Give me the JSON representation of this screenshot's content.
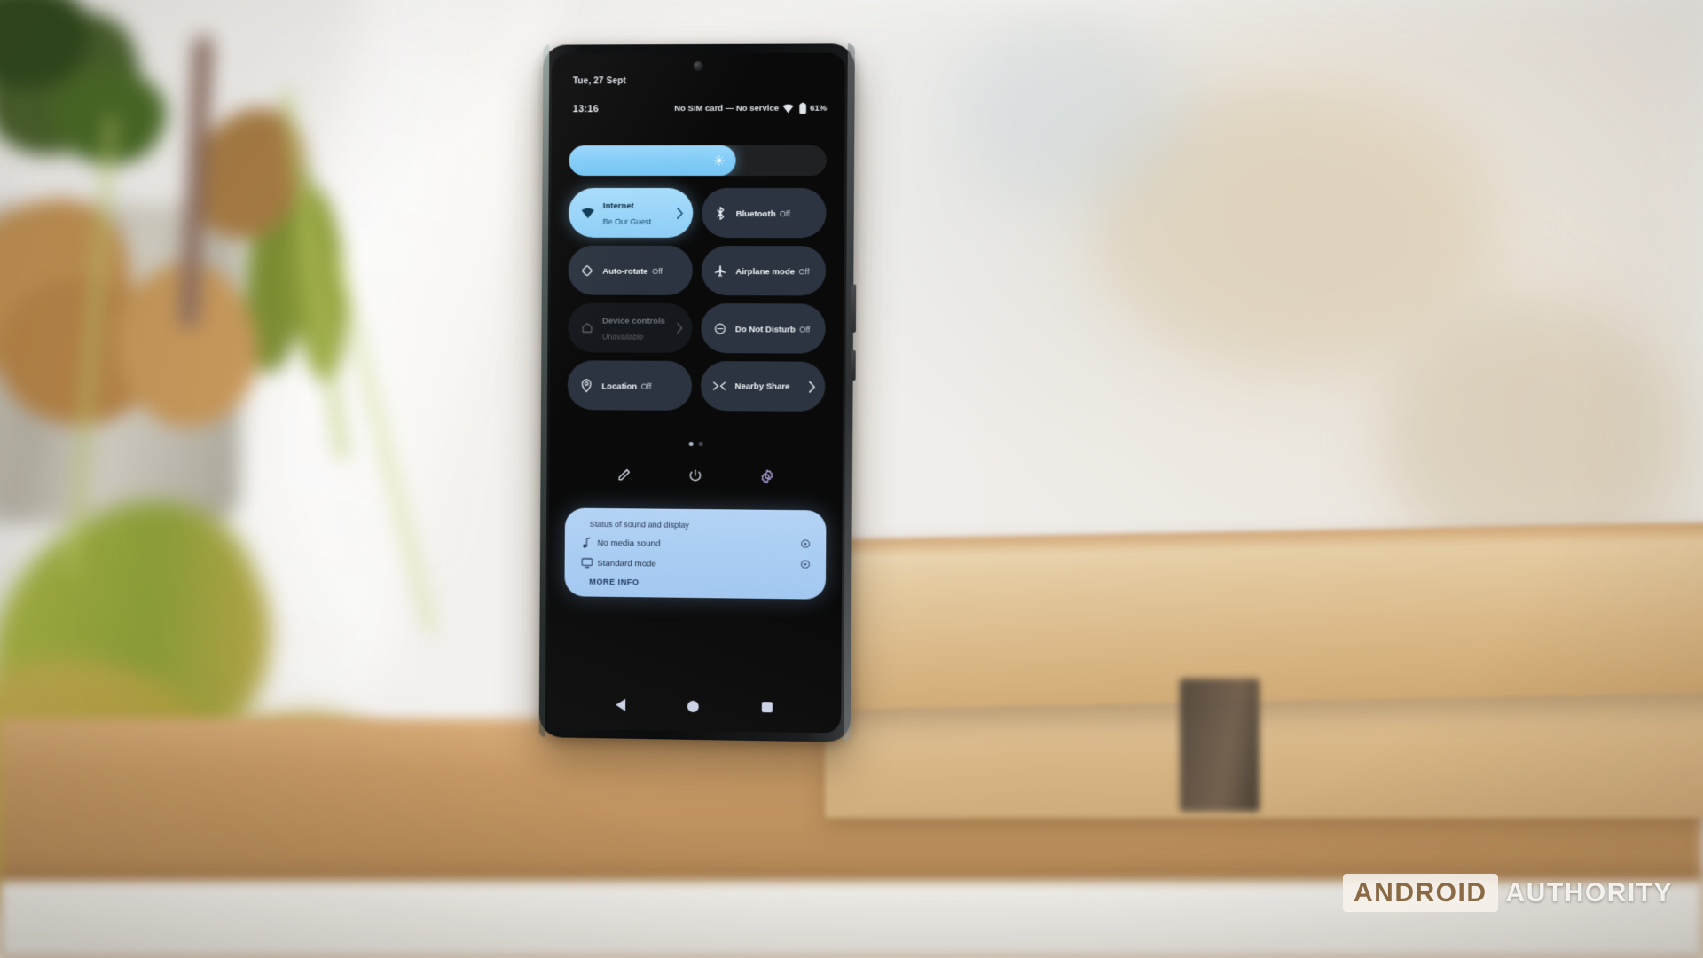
{
  "scene": {
    "watermark": {
      "brand_primary": "ANDROID",
      "brand_secondary": "AUTHORITY",
      "color_box": "#f7f3ec",
      "color_primary_text": "#8a6a45",
      "color_secondary_text": "#faf8f4"
    }
  },
  "phone": {
    "status_bar": {
      "date": "Tue, 27 Sept",
      "clock": "13:16",
      "carrier": "No SIM card — No service",
      "wifi_icon": "wifi-icon",
      "battery_icon": "battery-icon",
      "battery_level": "61%"
    },
    "brightness": {
      "label": "Brightness",
      "value_percent": 65,
      "icon": "brightness-icon",
      "fill_color": "#8ecdf6",
      "track_color": "#1f2123"
    },
    "quick_settings": {
      "tiles": [
        {
          "title": "Internet",
          "subtitle": "Be Our Guest",
          "icon": "wifi-icon",
          "state": "active",
          "has_chevron": true
        },
        {
          "title": "Bluetooth",
          "subtitle": "Off",
          "icon": "bluetooth-icon",
          "state": "inactive",
          "has_chevron": false
        },
        {
          "title": "Auto-rotate",
          "subtitle": "Off",
          "icon": "auto-rotate-icon",
          "state": "inactive",
          "has_chevron": false
        },
        {
          "title": "Airplane mode",
          "subtitle": "Off",
          "icon": "airplane-icon",
          "state": "inactive",
          "has_chevron": false
        },
        {
          "title": "Device controls",
          "subtitle": "Unavailable",
          "icon": "home-icon",
          "state": "disabled",
          "has_chevron": true
        },
        {
          "title": "Do Not Disturb",
          "subtitle": "Off",
          "icon": "do-not-disturb-icon",
          "state": "inactive",
          "has_chevron": false
        },
        {
          "title": "Location",
          "subtitle": "Off",
          "icon": "location-pin-icon",
          "state": "inactive",
          "has_chevron": false
        },
        {
          "title": "Nearby Share",
          "subtitle": "",
          "icon": "nearby-share-icon",
          "state": "inactive",
          "has_chevron": true
        }
      ],
      "pagination": {
        "pages": 2,
        "current": 1
      }
    },
    "footer_actions": [
      {
        "name": "edit-tiles-button",
        "icon": "pencil-icon"
      },
      {
        "name": "power-menu-button",
        "icon": "power-icon"
      },
      {
        "name": "settings-button",
        "icon": "gear-icon"
      }
    ],
    "notification": {
      "header": "Status of sound and display",
      "rows": [
        {
          "label": "No media sound",
          "icon": "music-note-icon",
          "action_icon": "settings-dot-icon"
        },
        {
          "label": "Standard mode",
          "icon": "monitor-icon",
          "action_icon": "settings-dot-icon"
        }
      ],
      "more_info": "MORE INFO",
      "card_color": "#aacdf3"
    },
    "nav_bar": [
      {
        "name": "nav-back-button",
        "icon": "back-triangle-icon"
      },
      {
        "name": "nav-home-button",
        "icon": "home-circle-icon"
      },
      {
        "name": "nav-recents-button",
        "icon": "recents-square-icon"
      }
    ]
  }
}
